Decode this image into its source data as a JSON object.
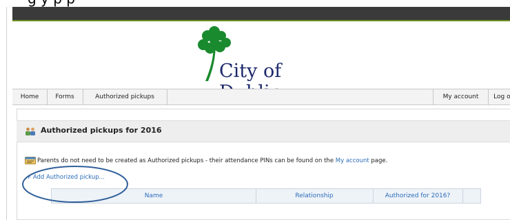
{
  "window": {
    "cropped_header_text": "g y p p"
  },
  "colors": {
    "topbar": "#3a3a3a",
    "topbar_accent": "#6b8e23",
    "brand_green": "#1a8a2e",
    "brand_navy": "#1c2a6b",
    "link": "#2b6cb8",
    "annotation": "#2f5f9a"
  },
  "logo": {
    "text": "City of Dublin",
    "icon": "shamrock-icon"
  },
  "nav": {
    "home": "Home",
    "forms": "Forms",
    "authorized_pickups": "Authorized pickups",
    "my_account": "My account",
    "log_out": "Log out"
  },
  "panel": {
    "icon": "people-icon",
    "title": "Authorized pickups for 2016"
  },
  "info": {
    "icon": "info-card-icon",
    "text_before": "Parents do not need to be created as Authorized pickups - their attendance PINs can be found on the ",
    "link": "My account",
    "text_after": " page."
  },
  "add_link": "+ Add Authorized pickup...",
  "table": {
    "columns": [
      "Name",
      "Relationship",
      "Authorized for 2016?",
      ""
    ]
  }
}
